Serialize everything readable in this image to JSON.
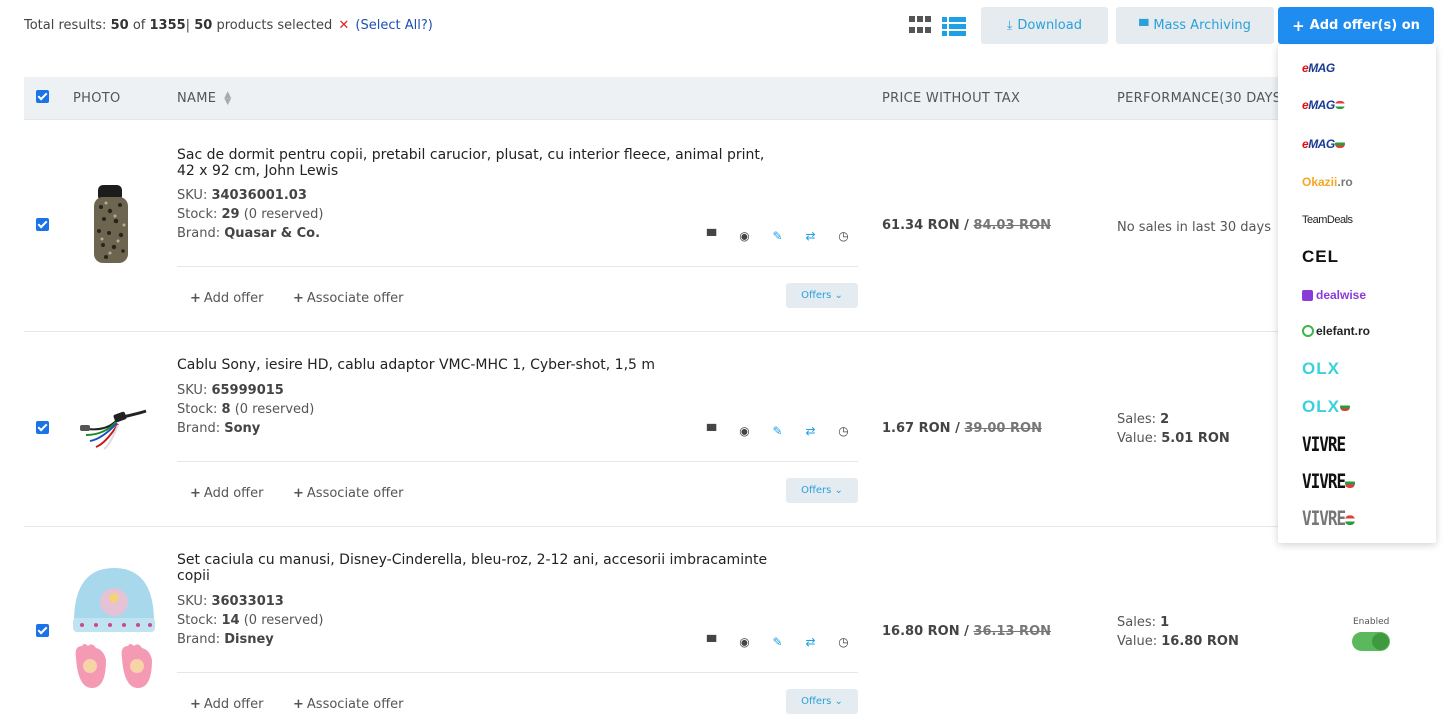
{
  "toolbar": {
    "results_prefix": "Total results:",
    "results_count": "50",
    "results_of": "of",
    "results_total": "1355",
    "results_sep": "|",
    "selected_count": "50",
    "selected_label": "products selected",
    "clear_symbol": "✕",
    "select_all": "(Select All?)",
    "download_label": "Download",
    "mass_archiving_label": "Mass Archiving",
    "add_offers_label": "Add offer(s) on"
  },
  "table": {
    "headers": {
      "photo": "PHOTO",
      "name": "NAME",
      "price": "PRICE WITHOUT TAX",
      "performance": "PERFORMANCE(30 DAYS)"
    },
    "labels": {
      "sku": "SKU:",
      "stock": "Stock:",
      "brand": "Brand:",
      "add_offer": "Add offer",
      "associate_offer": "Associate offer",
      "offers": "Offers",
      "sales": "Sales:",
      "value": "Value:"
    },
    "rows": [
      {
        "name": "Sac de dormit pentru copii, pretabil carucior, plusat, cu interior fleece, animal print, 42 x 92 cm, John Lewis",
        "sku": "34036001.03",
        "stock": "29",
        "reserved": "(0 reserved)",
        "brand": "Quasar & Co.",
        "price": "61.34 RON",
        "price_sep": "/",
        "old_price": "84.03 RON",
        "performance_text": "No sales in last 30 days"
      },
      {
        "name": "Cablu Sony, iesire HD, cablu adaptor VMC-MHC 1, Cyber-shot, 1,5 m",
        "sku": "65999015",
        "stock": "8",
        "reserved": "(0 reserved)",
        "brand": "Sony",
        "price": "1.67 RON",
        "price_sep": "/",
        "old_price": "39.00 RON",
        "sales": "2",
        "value": "5.01 RON"
      },
      {
        "name": "Set caciula cu manusi, Disney-Cinderella, bleu-roz, 2-12 ani, accesorii imbracaminte copii",
        "sku": "36033013",
        "stock": "14",
        "reserved": "(0 reserved)",
        "brand": "Disney",
        "price": "16.80 RON",
        "price_sep": "/",
        "old_price": "36.13 RON",
        "sales": "1",
        "value": "16.80 RON",
        "status": "Enabled"
      }
    ]
  },
  "marketplaces": {
    "emag_e": "e",
    "emag_m": "MAG",
    "okazii_o": "Okazii",
    "okazii_r": ".ro",
    "teamdeals": "TeamDeals",
    "cel": "CEL",
    "dealwise": "dealwise",
    "elefant": "elefant.ro",
    "olx": "OLX",
    "vivre": "VIVRE"
  },
  "colors": {
    "primary": "#1f8cef",
    "accent": "#2aa1d8",
    "toggle_on": "#5cb85c",
    "danger": "#e02424"
  }
}
